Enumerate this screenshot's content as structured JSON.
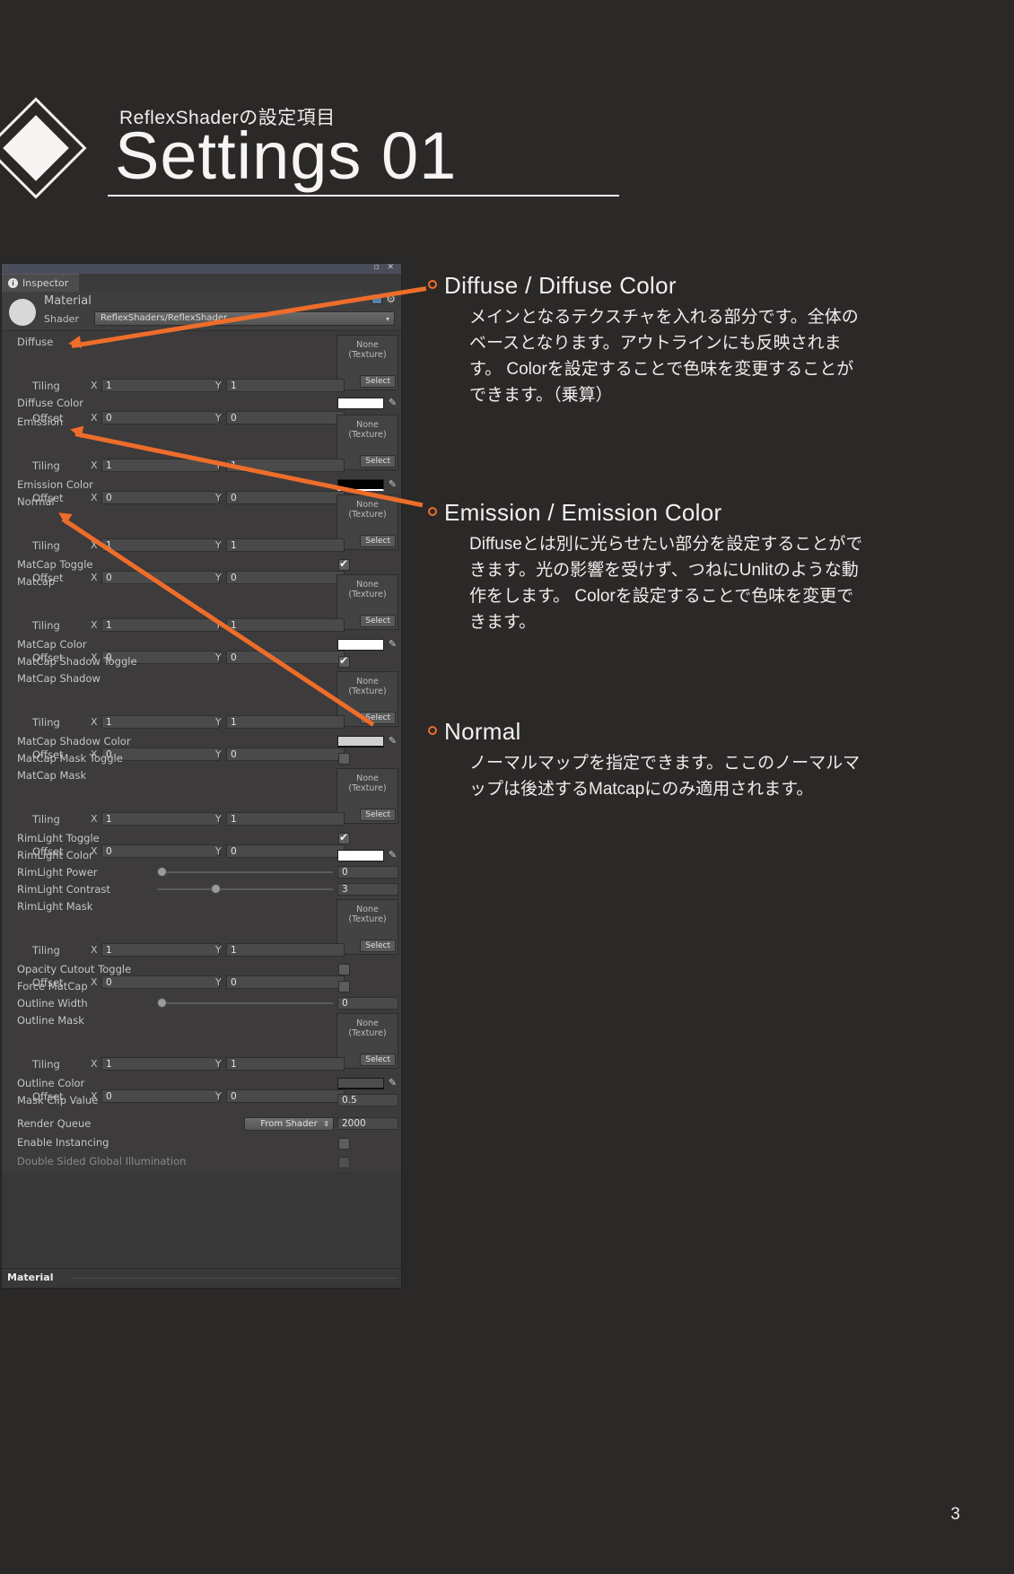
{
  "header": {
    "subtitle": "ReflexShaderの設定項目",
    "title": "Settings 01"
  },
  "page_number": "3",
  "accent_color": "#ee6d2a",
  "inspector": {
    "window_buttons": "▫ ✕",
    "tab_label": "Inspector",
    "tab_icon": "info-icon",
    "material_name": "Material",
    "shader_label": "Shader",
    "shader_value": "ReflexShaders/ReflexShader",
    "dropdown_arrow": "▾",
    "footer_label": "Material",
    "select_label": "Select",
    "texture_none_line1": "None",
    "texture_none_line2": "(Texture)",
    "tiling_label": "Tiling",
    "offset_label": "Offset",
    "axis_x": "X",
    "axis_y": "Y",
    "tiling_x": "1",
    "tiling_y": "1",
    "offset_x": "0",
    "offset_y": "0",
    "rows": {
      "diffuse": "Diffuse",
      "diffuse_color": "Diffuse Color",
      "emission": "Emission",
      "emission_color": "Emission Color",
      "normal": "Normal",
      "matcap_toggle": "MatCap Toggle",
      "matcap": "Matcap",
      "matcap_color": "MatCap Color",
      "matcap_shadow_toggle": "MatCap Shadow Toggle",
      "matcap_shadow": "MatCap Shadow",
      "matcap_shadow_color": "MatCap Shadow Color",
      "matcap_mask_toggle": "MatCap Mask Toggle",
      "matcap_mask": "MatCap Mask",
      "rimlight_toggle": "RimLight Toggle",
      "rimlight_color": "RimLight Color",
      "rimlight_power": "RimLight Power",
      "rimlight_contrast": "RimLight Contrast",
      "rimlight_mask": "RimLight Mask",
      "opacity_cutout_toggle": "Opacity Cutout Toggle",
      "force_matcap": "Force MatCap",
      "outline_width": "Outline Width",
      "outline_mask": "Outline Mask",
      "outline_color": "Outline Color",
      "mask_clip_value": "Mask Clip Value",
      "render_queue": "Render Queue",
      "enable_instancing": "Enable Instancing",
      "double_sided_gi": "Double Sided Global Illumination"
    },
    "values": {
      "rimlight_power": "0",
      "rimlight_contrast": "3",
      "outline_width": "0",
      "mask_clip_value": "0.5",
      "render_queue_source": "From Shader",
      "render_queue_value": "2000"
    },
    "colors": {
      "diffuse_color": "#ffffff",
      "emission_color": "#000000",
      "matcap_color": "#ffffff",
      "matcap_shadow_color": "#d0d0d0",
      "rimlight_color": "#ffffff",
      "outline_color": "#4d4d4d"
    }
  },
  "notes": [
    {
      "title": "Diffuse / Diffuse Color",
      "body": "メインとなるテクスチャを入れる部分です。全体のベースとなります。アウトラインにも反映されます。\nColorを設定することで色味を変更することができます。（乗算）"
    },
    {
      "title": "Emission / Emission Color",
      "body": "Diffuseとは別に光らせたい部分を設定することができます。光の影響を受けず、つねにUnlitのような動作をします。\nColorを設定することで色味を変更できます。"
    },
    {
      "title": "Normal",
      "body": "ノーマルマップを指定できます。ここのノーマルマップは後述するMatcapにのみ適用されます。"
    }
  ]
}
